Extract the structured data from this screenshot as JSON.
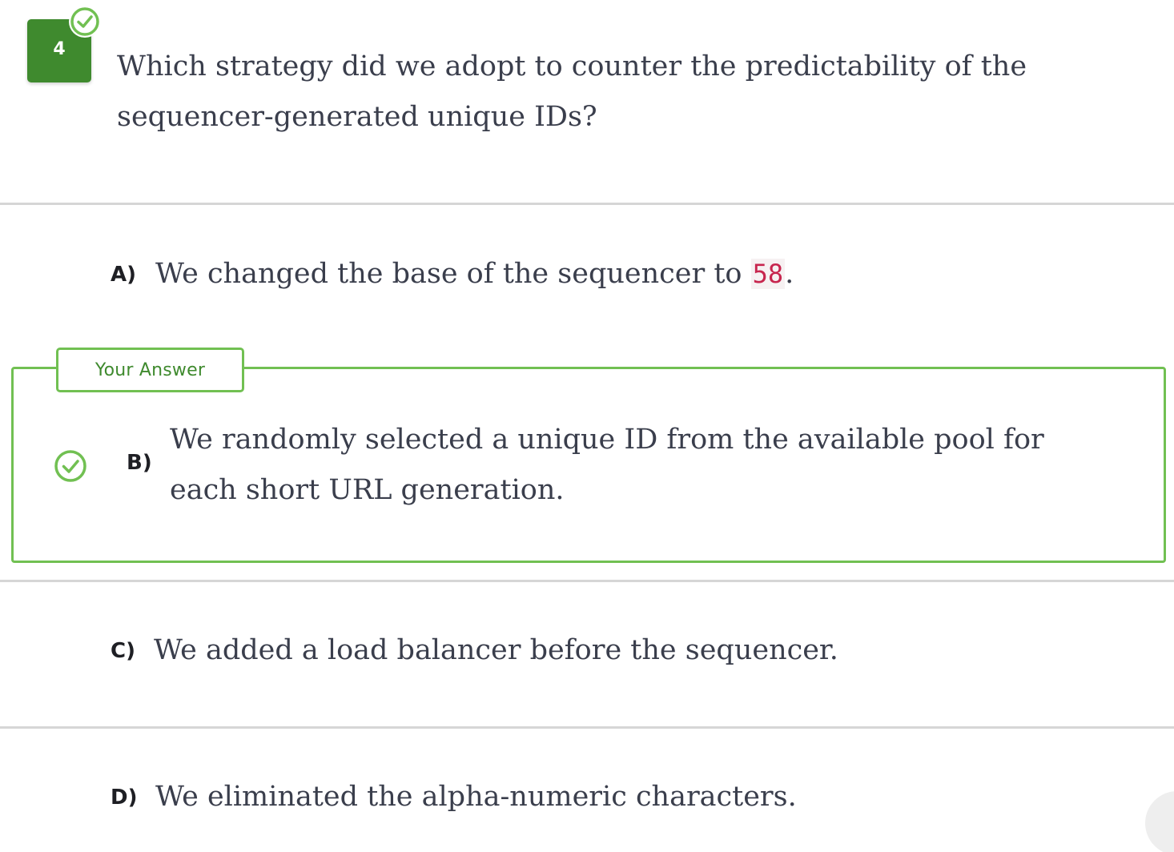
{
  "question": {
    "number": "4",
    "status_icon": "check-circle-icon",
    "text": "Which strategy did we adopt to counter the predictability of the sequencer-generated unique IDs?"
  },
  "options": {
    "a": {
      "letter": "A)",
      "text_before": "We changed the base of the sequencer to ",
      "code": "58",
      "text_after": "."
    },
    "b": {
      "letter": "B)",
      "text": "We randomly selected a unique ID from the available pool for each short URL generation.",
      "tag": "Your Answer",
      "status_icon": "check-circle-icon"
    },
    "c": {
      "letter": "C)",
      "text": "We added a load balancer before the sequencer."
    },
    "d": {
      "letter": "D)",
      "text": "We eliminated the alpha-numeric characters."
    }
  },
  "colors": {
    "correct_green": "#71c052",
    "badge_green": "#3f8a2e",
    "code_red": "#c7254e",
    "divider": "#d6d6d6"
  }
}
